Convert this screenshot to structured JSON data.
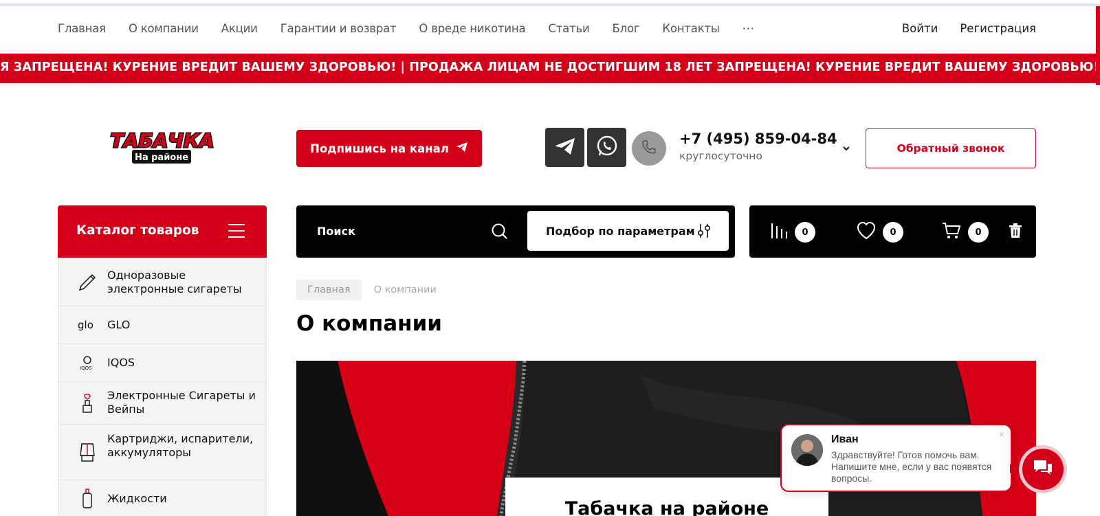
{
  "nav": {
    "items": [
      "Главная",
      "О компании",
      "Акции",
      "Гарантии и возврат",
      "О вреде никотина",
      "Статьи",
      "Блог",
      "Контакты"
    ],
    "more": "···",
    "login": "Войти",
    "register": "Регистрация"
  },
  "ticker": {
    "text": "Я ЗАПРЕЩЕНА! КУРЕНИЕ ВРЕДИТ ВАШЕМУ ЗДОРОВЬЮ! | ПРОДАЖА ЛИЦАМ НЕ ДОСТИГШИМ 18 ЛЕТ ЗАПРЕЩЕНА! КУРЕНИЕ ВРЕДИТ ВАШЕМУ ЗДОРОВЬЮ!"
  },
  "header": {
    "logo_line1": "ТАБАЧКА",
    "logo_line2": "На районе",
    "subscribe_label": "Подпишись на канал",
    "phone": "+7 (495) 859-04-84",
    "phone_hours": "круглосуточно",
    "callback_label": "Обратный звонок"
  },
  "catalog": {
    "title": "Каталог товаров",
    "items": [
      {
        "label": "Одноразовые электронные сигареты",
        "icon": "pen-icon"
      },
      {
        "label": "GLO",
        "icon": "glo-icon"
      },
      {
        "label": "IQOS",
        "icon": "iqos-icon"
      },
      {
        "label": "Электронные Сигареты и Вейпы",
        "icon": "vape-icon"
      },
      {
        "label": "Картриджи, испарители, аккумуляторы",
        "icon": "cartridge-icon"
      },
      {
        "label": "Жидкости",
        "icon": "bottle-icon"
      }
    ]
  },
  "search": {
    "placeholder": "Поиск",
    "filter_label": "Подбор по параметрам"
  },
  "actions": {
    "compare_count": "0",
    "favorites_count": "0",
    "cart_count": "0"
  },
  "breadcrumbs": {
    "home": "Главная",
    "current": "О компании"
  },
  "page": {
    "title": "О компании",
    "hero_heading": "Табачка на районе"
  },
  "chat": {
    "name": "Иван",
    "message": "Здравствуйте! Готов помочь вам. Напишите мне, если у вас появятся вопросы.",
    "close": "×"
  },
  "colors": {
    "brand_red": "#d40019",
    "black": "#000000",
    "sidebar_bg": "#f4f4f4"
  }
}
